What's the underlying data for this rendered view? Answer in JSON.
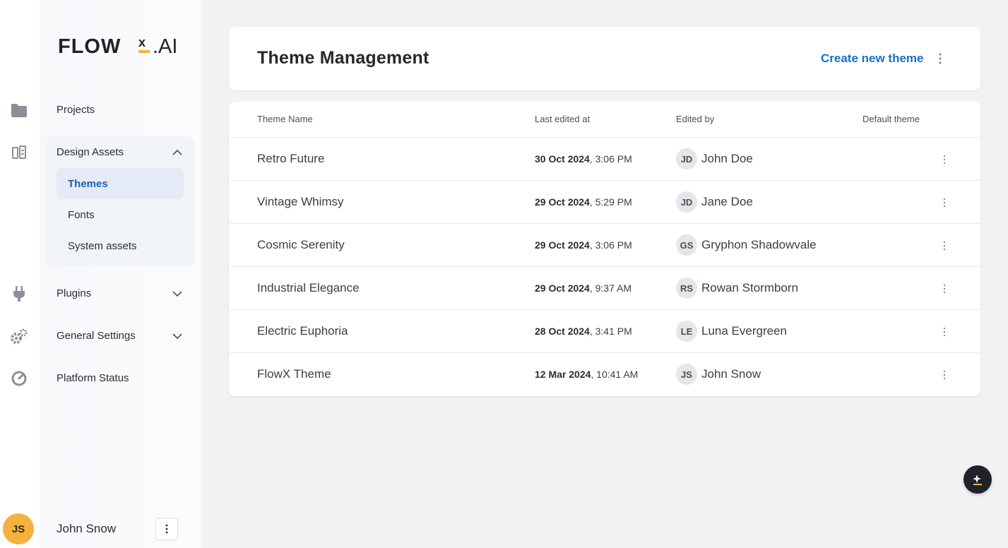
{
  "logo": {
    "text": "FLOWX.AI"
  },
  "nav": {
    "projects": "Projects",
    "design_assets": "Design Assets",
    "sub_items": [
      "Themes",
      "Fonts",
      "System assets"
    ],
    "plugins": "Plugins",
    "general_settings": "General Settings",
    "platform_status": "Platform Status"
  },
  "user": {
    "initials": "JS",
    "name": "John Snow"
  },
  "header": {
    "title": "Theme Management",
    "create_label": "Create new theme"
  },
  "table": {
    "columns": [
      "Theme Name",
      "Last edited at",
      "Edited by",
      "Default theme"
    ],
    "rows": [
      {
        "name": "Retro Future",
        "date": "30 Oct 2024",
        "time": ", 3:06 PM",
        "initials": "JD",
        "editor": "John Doe"
      },
      {
        "name": "Vintage Whimsy",
        "date": "29 Oct 2024",
        "time": ", 5:29 PM",
        "initials": "JD",
        "editor": "Jane Doe"
      },
      {
        "name": "Cosmic Serenity",
        "date": "29 Oct 2024",
        "time": ", 3:06 PM",
        "initials": "GS",
        "editor": "Gryphon Shadowvale"
      },
      {
        "name": "Industrial Elegance",
        "date": "29 Oct 2024",
        "time": ", 9:37 AM",
        "initials": "RS",
        "editor": "Rowan Stormborn"
      },
      {
        "name": "Electric Euphoria",
        "date": "28 Oct 2024",
        "time": ", 3:41 PM",
        "initials": "LE",
        "editor": "Luna Evergreen"
      },
      {
        "name": "FlowX Theme",
        "date": "12 Mar 2024",
        "time": ", 10:41 AM",
        "initials": "JS",
        "editor": "John Snow"
      }
    ]
  },
  "colors": {
    "accent": "#1a6fc9",
    "avatar": "#f5b13d",
    "logo_mark": "#f5b13d"
  }
}
